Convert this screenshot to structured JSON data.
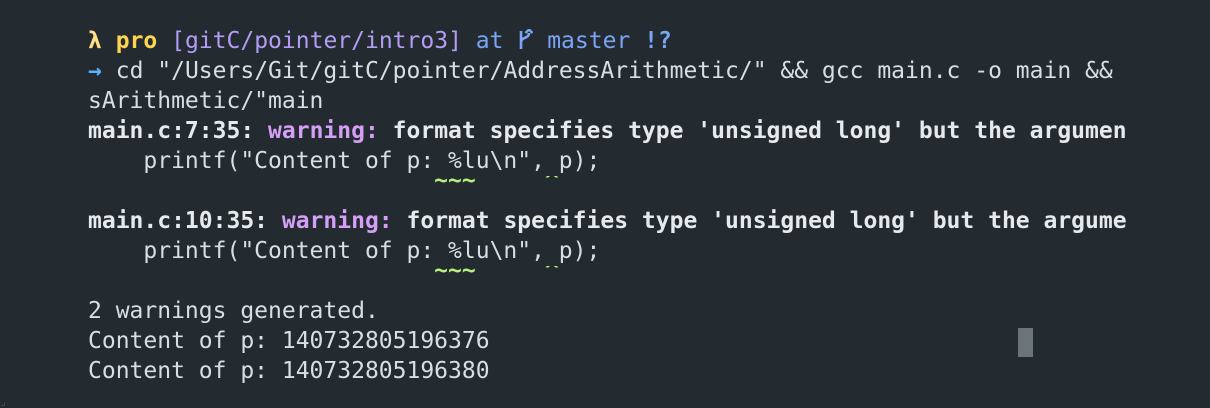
{
  "prompt": {
    "lambda": "λ",
    "user": "pro",
    "path": "[gitC/pointer/intro3]",
    "at": "at",
    "branch_icon": "git-branch-icon",
    "branch": "master",
    "status": "!?"
  },
  "command": {
    "arrow": "→",
    "text": "cd \"/Users/Git/gitC/pointer/AddressArithmetic/\" && gcc main.c -o main && ",
    "continuation": "sArithmetic/\"main"
  },
  "warnings": [
    {
      "location": "main.c:7:35:",
      "label": "warning:",
      "message": "format specifies type 'unsigned long' but the argumen",
      "code": "    printf(\"Content of p: %lu\\n\", p);",
      "markers": "                         ~~~     ^"
    },
    {
      "location": "main.c:10:35:",
      "label": "warning:",
      "message": "format specifies type 'unsigned long' but the argume",
      "code": "    printf(\"Content of p: %lu\\n\", p);",
      "markers": "                         ~~~     ^"
    }
  ],
  "output": [
    "",
    "2 warnings generated.",
    "Content of p: 140732805196376",
    "Content of p: 140732805196380"
  ],
  "colors": {
    "background": "#232b30",
    "foreground": "#d8dee3",
    "path": "#b49cf5",
    "branch": "#7aa4f5",
    "warning": "#d59ef7",
    "marker": "#b6f07a"
  }
}
